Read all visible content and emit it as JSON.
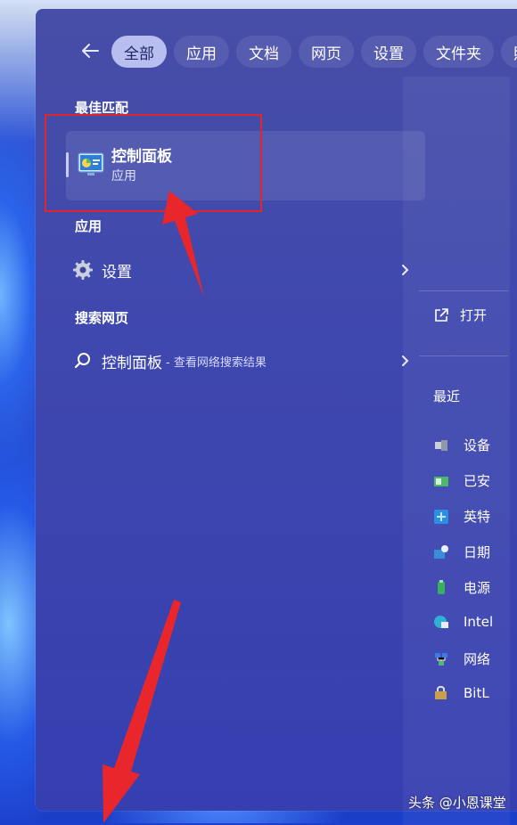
{
  "filters": {
    "chips": [
      "全部",
      "应用",
      "文档",
      "网页",
      "设置",
      "文件夹",
      "照"
    ],
    "active_index": 0
  },
  "best_match": {
    "heading": "最佳匹配",
    "title": "控制面板",
    "subtitle": "应用",
    "icon": "control-panel-icon"
  },
  "apps": {
    "heading": "应用",
    "items": [
      {
        "label": "设置",
        "icon": "gear-icon"
      }
    ]
  },
  "web": {
    "heading": "搜索网页",
    "items": [
      {
        "label": "控制面板",
        "hint": "- 查看网络搜索结果",
        "icon": "search-icon"
      }
    ]
  },
  "details": {
    "open_label": "打开",
    "recent_heading": "最近",
    "recent_items": [
      {
        "label": "设备",
        "icon": "devices-icon"
      },
      {
        "label": "已安",
        "icon": "programs-icon"
      },
      {
        "label": "英特",
        "icon": "intel-graphics-icon"
      },
      {
        "label": "日期",
        "icon": "date-time-icon"
      },
      {
        "label": "电源",
        "icon": "power-icon"
      },
      {
        "label": "Intel",
        "icon": "internet-options-icon"
      },
      {
        "label": "网络",
        "icon": "network-icon"
      },
      {
        "label": "BitL",
        "icon": "bitlocker-icon"
      }
    ]
  },
  "watermark": "头条 @小恩课堂",
  "colors": {
    "panel": "#3f48ae",
    "active_chip": "#b8bff0",
    "highlight": "#e0252b"
  }
}
